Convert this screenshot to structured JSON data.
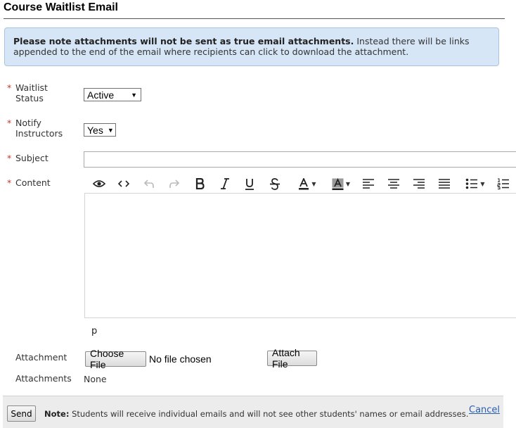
{
  "page": {
    "title": "Course Waitlist Email"
  },
  "notice": {
    "bold": "Please note attachments will not be sent as true email attachments.",
    "text": " Instead there will be links appended to the end of the email where recipients can click to download the attachment."
  },
  "form": {
    "required_marker": "*",
    "waitlist_status": {
      "label_line1": "Waitlist",
      "label_line2": "Status",
      "value": "Active"
    },
    "notify_instructors": {
      "label_line1": "Notify",
      "label_line2": "Instructors",
      "value": "Yes"
    },
    "subject": {
      "label": "Subject",
      "value": ""
    },
    "content": {
      "label": "Content",
      "path": "p"
    },
    "attachment": {
      "label": "Attachment",
      "choose_label": "Choose File",
      "status": "No file chosen",
      "attach_label": "Attach File"
    },
    "attachments": {
      "label": "Attachments",
      "value": "None"
    }
  },
  "toolbar": {
    "icons": [
      "eye-icon",
      "code-icon",
      "undo-icon",
      "redo-icon",
      "bold-icon",
      "italic-icon",
      "underline-icon",
      "strikethrough-icon",
      "font-color-icon",
      "highlight-color-icon",
      "align-left-icon",
      "align-center-icon",
      "align-right-icon",
      "align-justify-icon",
      "bullet-list-icon",
      "numbered-list-icon"
    ]
  },
  "footer": {
    "send_label": "Send",
    "note_bold": "Note:",
    "note_text": " Students will receive individual emails and will not see other students' names or email addresses.",
    "cancel_label": "Cancel"
  },
  "colors": {
    "notice_bg": "#d6e6f7",
    "required": "#c0392b",
    "link": "#2a5db0"
  }
}
